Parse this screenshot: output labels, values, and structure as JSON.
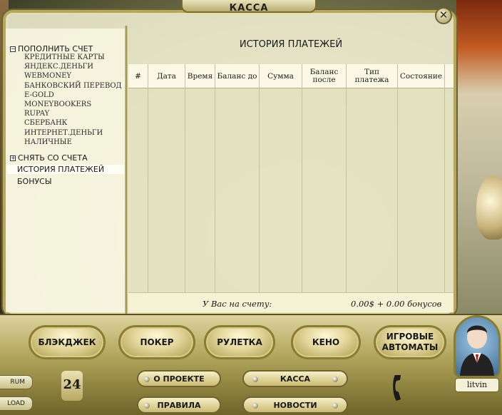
{
  "window": {
    "title": "КАССА",
    "close_icon": "✕"
  },
  "sidebar": {
    "deposit": {
      "label": "ПОПОЛНИТЬ СЧЕТ",
      "expander": "−",
      "items": [
        "КРЕДИТНЫЕ КАРТЫ",
        "ЯНДЕКС.ДЕНЬГИ",
        "WEBMONEY",
        "БАНКОВСКИЙ ПЕРЕВОД",
        "E-GOLD",
        "MONEYBOOKERS",
        "RUPAY",
        "СБЕРБАНК",
        "ИНТЕРНЕТ.ДЕНЬГИ",
        "НАЛИЧНЫЕ"
      ]
    },
    "withdraw": {
      "label": "СНЯТЬ СО СЧЕТА",
      "expander": "+"
    },
    "history": {
      "label": "ИСТОРИЯ ПЛАТЕЖЕЙ"
    },
    "bonuses": {
      "label": "БОНУСЫ"
    }
  },
  "main": {
    "title": "ИСТОРИЯ ПЛАТЕЖЕЙ",
    "columns": [
      "#",
      "Дата",
      "Время",
      "Баланс до",
      "Сумма",
      "Баланс после",
      "Тип платежа",
      "Состояние"
    ],
    "rows": [],
    "footer": {
      "label": "У Вас на счету:",
      "value": "0.00$ + 0.00 бонусов"
    }
  },
  "games": {
    "blackjack": "БЛЭКДЖЕК",
    "poker": "ПОКЕР",
    "roulette": "РУЛЕТКА",
    "keno": "КЕНО",
    "slots": "ИГРОВЫЕ АВТОМАТЫ"
  },
  "nav": {
    "about": "О ПРОЕКТЕ",
    "cashier": "КАССА",
    "rules": "ПРАВИЛА",
    "news": "НОВОСТИ"
  },
  "left_tabs": {
    "forum": "RUM",
    "download": "LOAD"
  },
  "logo": "24",
  "user": {
    "name": "litvin"
  }
}
